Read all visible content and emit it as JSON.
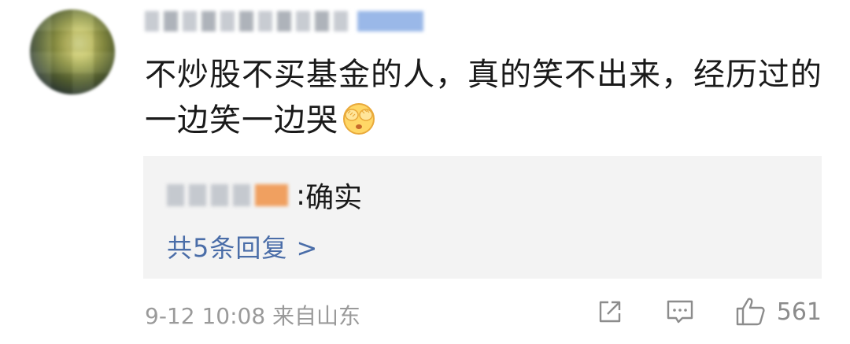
{
  "comment": {
    "text": "不炒股不买基金的人，真的笑不出来，经历过的一边笑一边哭",
    "emoji_icon": "face-covering-eyes-emoji"
  },
  "reply": {
    "separator": ": ",
    "text": "确实",
    "more_label": "共5条回复 >"
  },
  "footer": {
    "meta": "9-12 10:08 来自山东",
    "like_count": "561",
    "icons": [
      "share-icon",
      "comment-icon",
      "like-icon"
    ]
  },
  "colors": {
    "link": "#4a6da8",
    "meta": "#9a9a9a",
    "reply_bg": "#f3f3f3"
  }
}
